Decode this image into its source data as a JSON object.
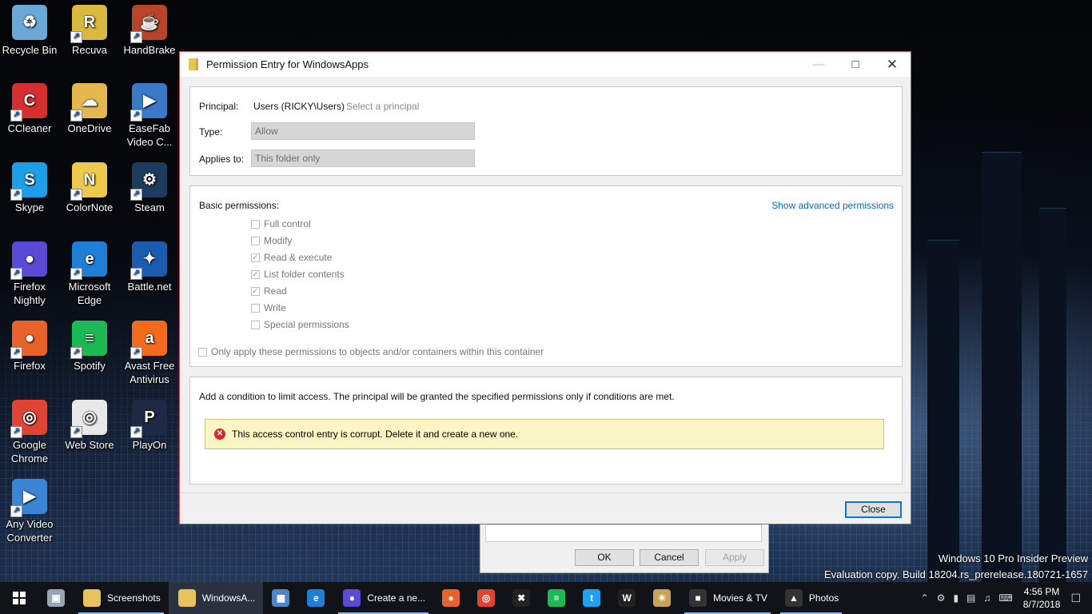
{
  "desktop": {
    "icons": [
      {
        "label": "Recycle Bin",
        "glyph": "♻",
        "color": "#6aa8d8",
        "icon": "recycle-bin-icon"
      },
      {
        "label": "Recuva",
        "glyph": "R",
        "color": "#d9b93e",
        "icon": "recuva-icon"
      },
      {
        "label": "HandBrake",
        "glyph": "☕",
        "color": "#b8452a",
        "icon": "handbrake-icon"
      },
      {
        "label": "CCleaner",
        "glyph": "C",
        "color": "#d62f2f",
        "icon": "ccleaner-icon"
      },
      {
        "label": "OneDrive",
        "glyph": "☁",
        "color": "#e4b84f",
        "icon": "onedrive-icon"
      },
      {
        "label": "EaseFab Video C...",
        "glyph": "▶",
        "color": "#3a78c8",
        "icon": "easefab-icon"
      },
      {
        "label": "Skype",
        "glyph": "S",
        "color": "#1c9ee8",
        "icon": "skype-icon"
      },
      {
        "label": "ColorNote",
        "glyph": "N",
        "color": "#efc94c",
        "icon": "colornote-icon"
      },
      {
        "label": "Steam",
        "glyph": "⚙",
        "color": "#1d3b5c",
        "icon": "steam-icon"
      },
      {
        "label": "Firefox Nightly",
        "glyph": "●",
        "color": "#5b4ad6",
        "icon": "firefox-nightly-icon"
      },
      {
        "label": "Microsoft Edge",
        "glyph": "e",
        "color": "#1f7fd6",
        "icon": "edge-icon"
      },
      {
        "label": "Battle.net",
        "glyph": "✦",
        "color": "#1a5cb0",
        "icon": "battlenet-icon"
      },
      {
        "label": "Firefox",
        "glyph": "●",
        "color": "#e8622a",
        "icon": "firefox-icon"
      },
      {
        "label": "Spotify",
        "glyph": "≡",
        "color": "#1db954",
        "icon": "spotify-icon"
      },
      {
        "label": "Avast Free Antivirus",
        "glyph": "a",
        "color": "#f26a1b",
        "icon": "avast-icon"
      },
      {
        "label": "Google Chrome",
        "glyph": "◎",
        "color": "#e04534",
        "icon": "chrome-icon"
      },
      {
        "label": "Web Store",
        "glyph": "◎",
        "color": "#e8e8e8",
        "icon": "webstore-icon"
      },
      {
        "label": "PlayOn",
        "glyph": "P",
        "color": "#1e2a44",
        "icon": "playon-icon"
      },
      {
        "label": "Any Video Converter",
        "glyph": "▶",
        "color": "#3a86d4",
        "icon": "any-video-converter-icon"
      }
    ]
  },
  "dialog": {
    "title": "Permission Entry for WindowsApps",
    "principal_label": "Principal:",
    "principal_value": "Users (RICKY\\Users)",
    "select_principal": "Select a principal",
    "type_label": "Type:",
    "type_value": "Allow",
    "applies_label": "Applies to:",
    "applies_value": "This folder only",
    "basic_permissions_label": "Basic permissions:",
    "show_advanced": "Show advanced permissions",
    "permissions": [
      {
        "label": "Full control",
        "checked": false
      },
      {
        "label": "Modify",
        "checked": false
      },
      {
        "label": "Read & execute",
        "checked": true
      },
      {
        "label": "List folder contents",
        "checked": true
      },
      {
        "label": "Read",
        "checked": true
      },
      {
        "label": "Write",
        "checked": false
      },
      {
        "label": "Special permissions",
        "checked": false
      }
    ],
    "only_apply": "Only apply these permissions to objects and/or containers within this container",
    "condition_text": "Add a condition to limit access. The principal will be granted the specified permissions only if conditions are met.",
    "error_text": "This access control entry is corrupt. Delete it and create a new one.",
    "close_button": "Close"
  },
  "background_dialog": {
    "ok": "OK",
    "cancel": "Cancel",
    "apply": "Apply"
  },
  "watermark": {
    "line1": "Windows 10 Pro Insider Preview",
    "line2": "Evaluation copy. Build 18204.rs_prerelease.180721-1657"
  },
  "taskbar": {
    "items": [
      {
        "label": "",
        "icon": "file-explorer-alt-icon",
        "glyph": "▣",
        "color": "#9aa6b3",
        "state": ""
      },
      {
        "label": "Screenshots",
        "icon": "folder-icon",
        "glyph": "",
        "color": "#e8c25a",
        "state": "running"
      },
      {
        "label": "WindowsA...",
        "icon": "folder-icon",
        "glyph": "",
        "color": "#e8c25a",
        "state": "active"
      },
      {
        "label": "",
        "icon": "control-panel-icon",
        "glyph": "▦",
        "color": "#4f86c6",
        "state": ""
      },
      {
        "label": "",
        "icon": "edge-beta-icon",
        "glyph": "e",
        "color": "#1f7fd6",
        "state": ""
      },
      {
        "label": "Create a ne...",
        "icon": "firefox-nightly-icon",
        "glyph": "●",
        "color": "#5b4ad6",
        "state": "running"
      },
      {
        "label": "",
        "icon": "firefox-icon",
        "glyph": "●",
        "color": "#e8622a",
        "state": ""
      },
      {
        "label": "",
        "icon": "chrome-icon",
        "glyph": "◎",
        "color": "#e04534",
        "state": ""
      },
      {
        "label": "",
        "icon": "xbox-icon",
        "glyph": "✖",
        "color": "#222",
        "state": ""
      },
      {
        "label": "",
        "icon": "spotify-icon",
        "glyph": "≡",
        "color": "#1db954",
        "state": ""
      },
      {
        "label": "",
        "icon": "twitter-icon",
        "glyph": "t",
        "color": "#1da1f2",
        "state": ""
      },
      {
        "label": "",
        "icon": "wwe-icon",
        "glyph": "W",
        "color": "#222",
        "state": ""
      },
      {
        "label": "",
        "icon": "weather-icon",
        "glyph": "☀",
        "color": "#c8a35a",
        "state": ""
      },
      {
        "label": "Movies & TV",
        "icon": "movies-tv-icon",
        "glyph": "■",
        "color": "#333",
        "state": "running"
      },
      {
        "label": "Photos",
        "icon": "photos-icon",
        "glyph": "▲",
        "color": "#333",
        "state": "running"
      }
    ],
    "time": "4:56 PM",
    "date": "8/7/2018"
  }
}
